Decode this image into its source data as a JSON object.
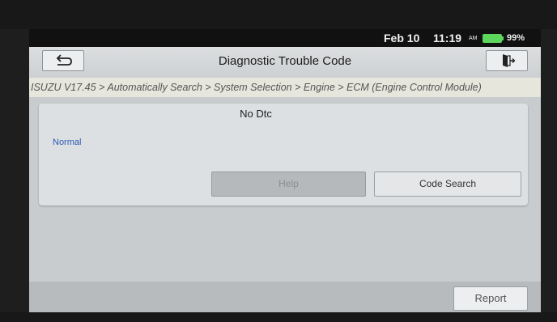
{
  "status_bar": {
    "date": "Feb 10",
    "time": "11:19",
    "ampm": "AM",
    "battery_percent": "99%",
    "battery_level": 0.99,
    "battery_color": "#5dd65d"
  },
  "header": {
    "title": "Diagnostic Trouble Code",
    "back_icon": "back-arrow-icon",
    "exit_icon": "exit-door-icon"
  },
  "breadcrumb": "ISUZU V17.45 > Automatically Search > System Selection > Engine > ECM (Engine Control Module)",
  "result": {
    "title": "No Dtc",
    "status": "Normal",
    "status_color": "#2a57b5"
  },
  "buttons": {
    "help": "Help",
    "code_search": "Code Search",
    "report": "Report"
  }
}
